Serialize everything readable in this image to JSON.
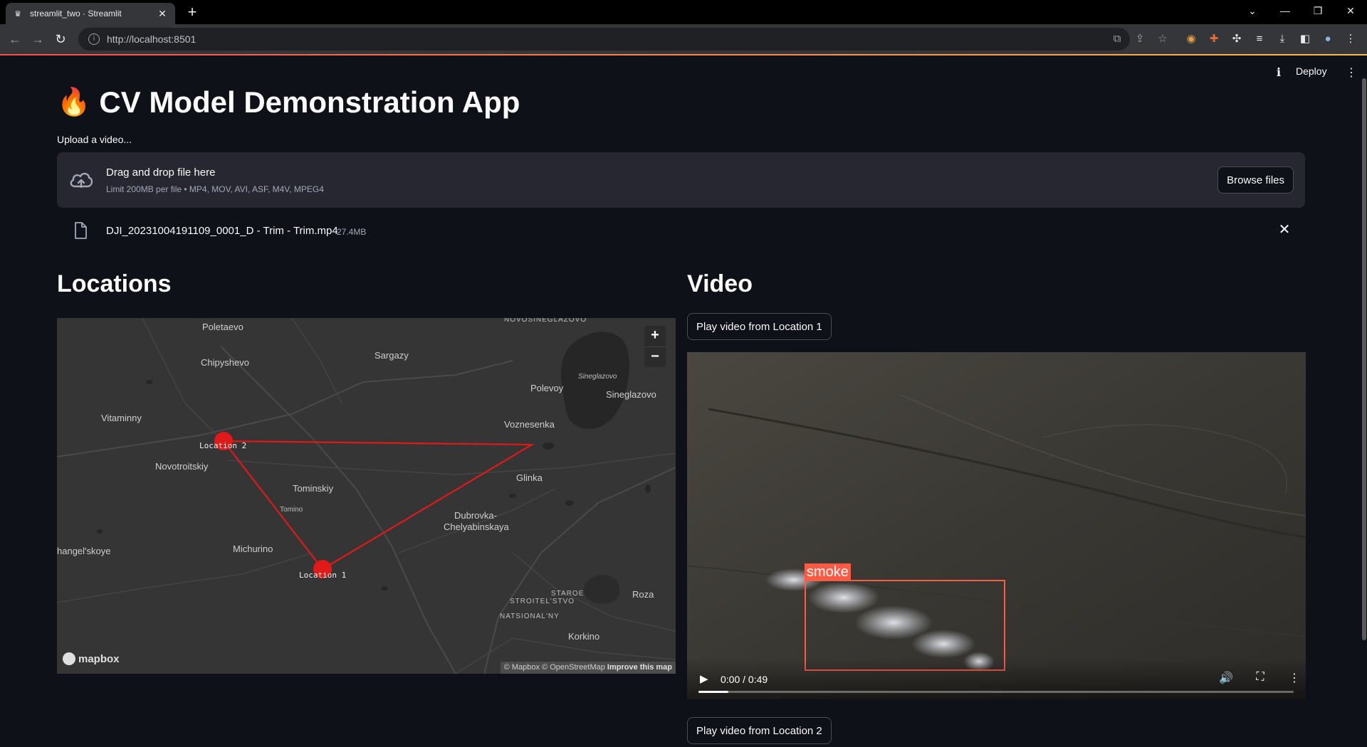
{
  "browser": {
    "tab_title": "streamlit_two · Streamlit",
    "tab_icon": "streamlit-crown-icon",
    "url": "http://localhost:8501"
  },
  "header": {
    "deploy_label": "Deploy"
  },
  "main": {
    "title": "CV Model Demonstration App",
    "title_emoji": "🔥",
    "upload_label": "Upload a video...",
    "dropzone_title": "Drag and drop file here",
    "dropzone_subtitle": "Limit 200MB per file • MP4, MOV, AVI, ASF, M4V, MPEG4",
    "browse_label": "Browse files",
    "file": {
      "name": "DJI_20231004191109_0001_D - Trim - Trim.mp4",
      "size": "27.4MB"
    }
  },
  "locations": {
    "heading": "Locations",
    "place_names": {
      "poletaevo": "Poletaevo",
      "chipyshevo": "Chipyshevo",
      "sargazy": "Sargazy",
      "novosineglazovo": "NOVOSINEGLAZOVO",
      "sineglazovo_lake": "Sineglazovo",
      "polevoy": "Polevoy",
      "sineglazovo": "Sineglazovo",
      "vitaminny": "Vitaminny",
      "voznesenka": "Voznesenka",
      "novotroitskiy": "Novotroitskiy",
      "glinka": "Glinka",
      "tominskiy": "Tominskiy",
      "tomino": "Tomino",
      "dubrovka": "Dubrovka-",
      "chelyabinskaya": "Chelyabinskaya",
      "arkhangelskoye": "hangel'skoye",
      "michurino": "Michurino",
      "staroe": "STAROE",
      "stroitelstvo": "STROITEL'STVO",
      "natsionalny": "NATSIONAL'NY",
      "roza": "Roza",
      "korkino": "Korkino"
    },
    "markers": [
      "Location 1",
      "Location 2"
    ],
    "zoom_in": "+",
    "zoom_out": "−",
    "logo_text": "mapbox",
    "attribution": "© Mapbox © OpenStreetMap",
    "improve": "Improve this map",
    "route_color": "#e01919"
  },
  "video": {
    "heading": "Video",
    "play_location_1": "Play video from Location 1",
    "play_location_2": "Play video from Location 2",
    "detection_label": "smoke",
    "time": "0:00 / 0:49",
    "progress": 0.05
  }
}
